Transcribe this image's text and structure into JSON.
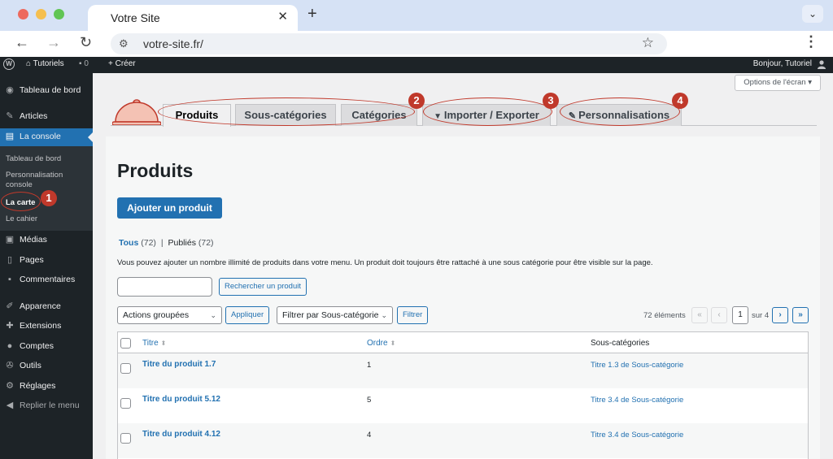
{
  "browser": {
    "tab_title": "Votre Site",
    "url": "votre-site.fr/"
  },
  "adminbar": {
    "site_name": "Tutoriels",
    "comments_count": "0",
    "new_label": "Créer",
    "greeting": "Bonjour, Tutoriel"
  },
  "sidebar": {
    "items": [
      {
        "label": "Tableau de bord",
        "icon": "dashboard-icon"
      },
      {
        "label": "Articles",
        "icon": "pin-icon"
      },
      {
        "label": "La console",
        "icon": "console-icon"
      },
      {
        "label": "Médias",
        "icon": "media-icon"
      },
      {
        "label": "Pages",
        "icon": "page-icon"
      },
      {
        "label": "Commentaires",
        "icon": "comment-icon"
      },
      {
        "label": "Apparence",
        "icon": "brush-icon"
      },
      {
        "label": "Extensions",
        "icon": "plugin-icon"
      },
      {
        "label": "Comptes",
        "icon": "user-icon"
      },
      {
        "label": "Outils",
        "icon": "wrench-icon"
      },
      {
        "label": "Réglages",
        "icon": "settings-icon"
      },
      {
        "label": "Replier le menu",
        "icon": "collapse-icon"
      }
    ],
    "submenu": [
      {
        "label": "Tableau de bord"
      },
      {
        "label": "Personnalisation console"
      },
      {
        "label": "La carte"
      },
      {
        "label": "Le cahier"
      }
    ]
  },
  "badges": [
    "1",
    "2",
    "3",
    "4"
  ],
  "screen_options": "Options de l'écran",
  "tabs": [
    {
      "label": "Produits",
      "active": true
    },
    {
      "label": "Sous-catégories"
    },
    {
      "label": "Catégories"
    },
    {
      "label": "Importer / Exporter",
      "icon": "import-icon"
    },
    {
      "label": "Personnalisations",
      "icon": "pin-icon"
    }
  ],
  "page": {
    "title": "Produits",
    "add_button": "Ajouter un produit",
    "filters": {
      "all_label": "Tous",
      "all_count": "(72)",
      "separator": "|",
      "published_label": "Publiés",
      "published_count": "(72)"
    },
    "description": "Vous pouvez ajouter un nombre illimité de produits dans votre menu. Un produit doit toujours être rattaché à une sous catégorie pour être visible sur la page.",
    "search_button": "Rechercher un produit",
    "search_value": "",
    "bulk_actions": "Actions groupées",
    "apply_button": "Appliquer",
    "filter_select": "Filtrer par Sous-catégorie",
    "filter_button": "Filtrer",
    "items_count": "72 éléments",
    "pagination": {
      "first": "«",
      "prev": "‹",
      "current": "1",
      "of_label": "sur 4",
      "next": "›",
      "last": "»"
    }
  },
  "table": {
    "columns": [
      "Titre",
      "Ordre",
      "Sous-catégories"
    ],
    "rows": [
      {
        "title": "Titre du produit 1.7",
        "order": "1",
        "subcategory": "Titre 1.3 de Sous-catégorie"
      },
      {
        "title": "Titre du produit 5.12",
        "order": "5",
        "subcategory": "Titre 3.4 de Sous-catégorie"
      },
      {
        "title": "Titre du produit 4.12",
        "order": "4",
        "subcategory": "Titre 3.4 de Sous-catégorie"
      }
    ]
  },
  "colors": {
    "wp_dark": "#1d2327",
    "wp_blue": "#2271b1",
    "annotation_red": "#c0392b"
  }
}
